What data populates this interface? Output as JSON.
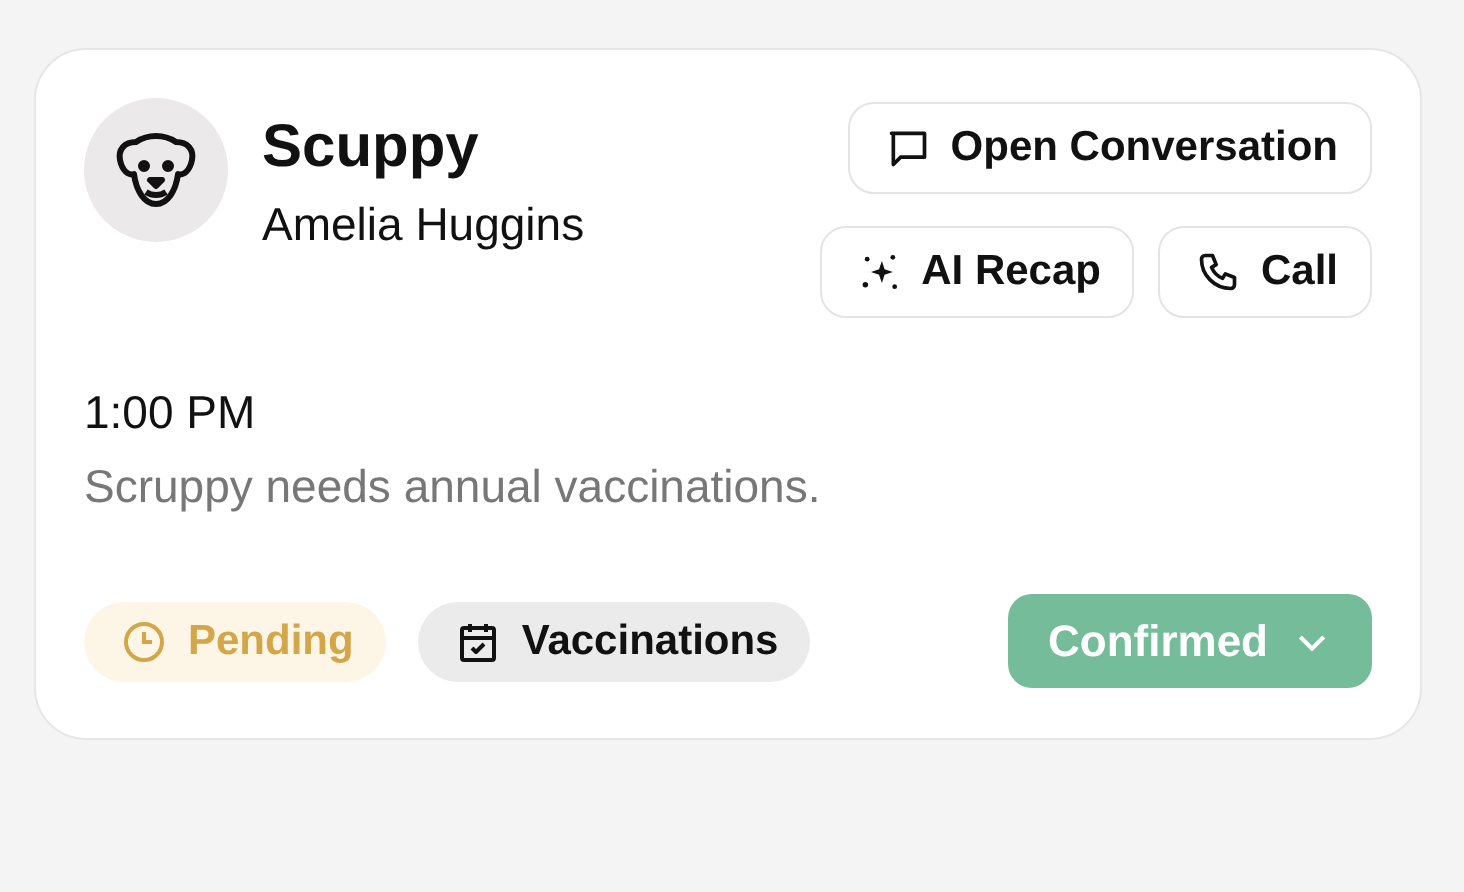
{
  "appointment": {
    "pet_name": "Scuppy",
    "owner_name": "Amelia Huggins",
    "time": "1:00 PM",
    "description": "Scruppy needs annual vaccinations.",
    "actions": [
      {
        "kind": "chat",
        "label": "Open Conversation"
      },
      {
        "kind": "sparkle",
        "label": "AI Recap"
      },
      {
        "kind": "phone",
        "label": "Call"
      }
    ],
    "tags": [
      {
        "kind": "clock",
        "label": "Pending",
        "color": "#d4a64a"
      },
      {
        "kind": "calendar",
        "label": "Vaccinations",
        "color": "#111111"
      }
    ],
    "status": {
      "label": "Confirmed"
    }
  }
}
